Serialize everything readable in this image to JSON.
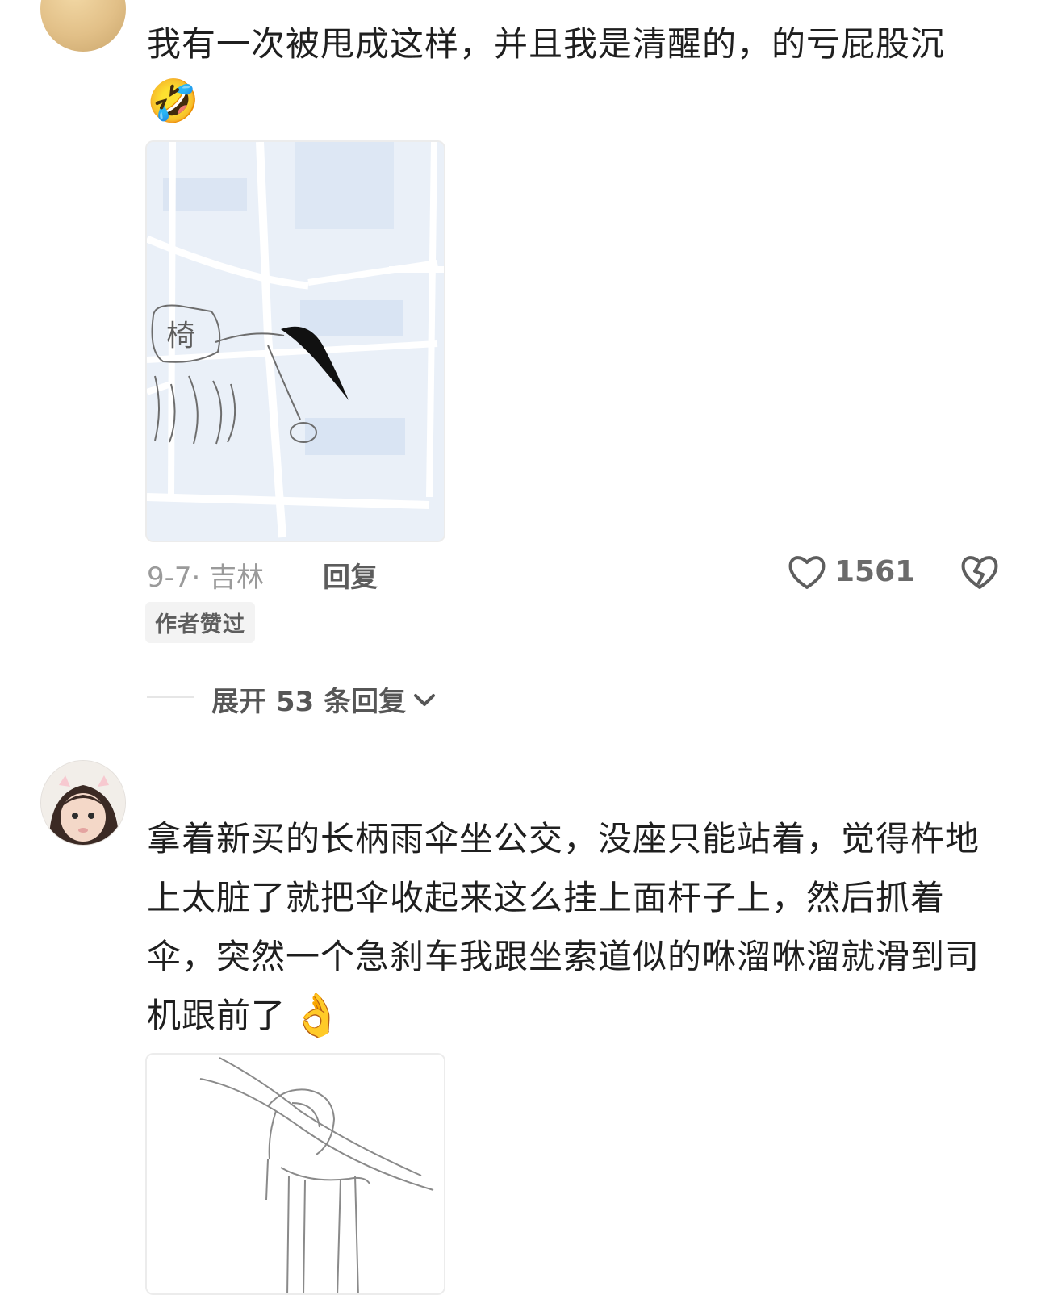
{
  "comment1": {
    "text": "我有一次被甩成这样，并且我是清醒的，的亏屁股沉",
    "emoji": "🤣",
    "meta": "9-7· 吉林",
    "reply_label": "回复",
    "likes": "1561",
    "badge": "作者赞过",
    "image_label": "椅",
    "expand_label": "展开 53 条回复"
  },
  "comment2": {
    "line1": "拿着新买的长柄雨伞坐公交，没座只能站着，觉得杵地",
    "line2": "上太脏了就把伞收起来这么挂上面杆子上，然后抓着",
    "line3": "伞，突然一个急刹车我跟坐索道似的咻溜咻溜就滑到司",
    "line4": "机跟前了",
    "emoji": "👌"
  },
  "icons": {
    "like": "heart-icon",
    "dislike": "broken-heart-icon",
    "expand": "chevron-down-icon"
  }
}
